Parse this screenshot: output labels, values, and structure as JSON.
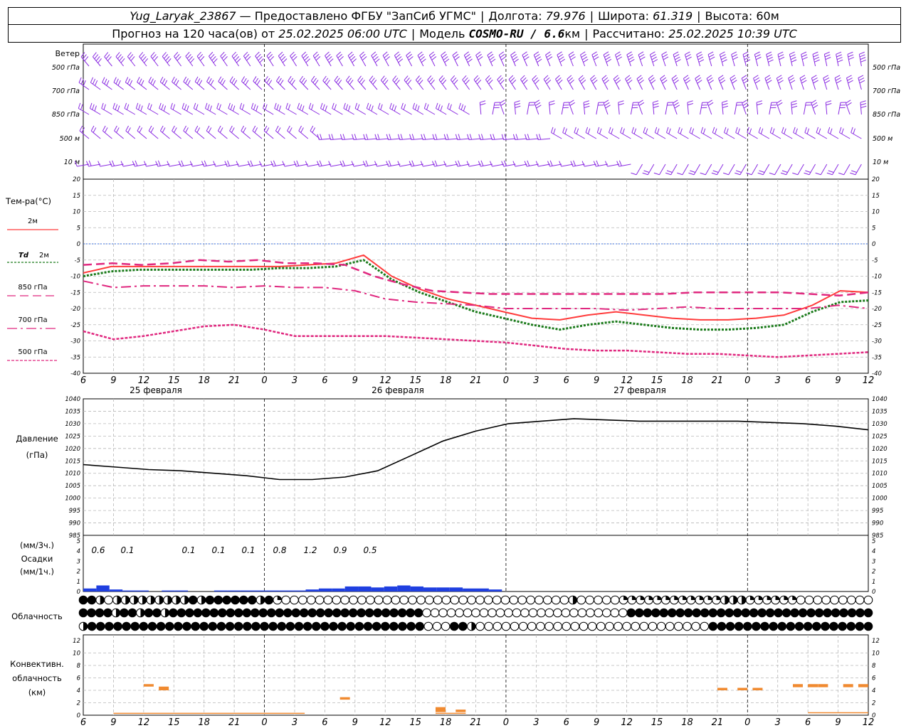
{
  "header": {
    "station": "Yug_Laryak_23867",
    "provider": "— Предоставлено ФГБУ \"ЗапСиб УГМС\"",
    "lon_label": "Долгота:",
    "lon": "79.976",
    "lat_label": "Широта:",
    "lat": "61.319",
    "alt_label": "Высота:",
    "alt": "60м",
    "forecast_label": "Прогноз на 120 часа(ов) от",
    "run": "25.02.2025 06:00 UTC",
    "model_label": "Модель",
    "model": "COSMO-RU / 6.6",
    "model_unit": "км",
    "calc_label": "Рассчитано:",
    "calc": "25.02.2025 10:39 UTC"
  },
  "colors": {
    "t2m": "#ff3b3b",
    "td2m": "#1a7a1a",
    "t850": "#e0287f",
    "wind": "#8a2be2",
    "precip": "#1f3fe0",
    "conv": "#f08a30",
    "pressure": "#000000",
    "zero": "#3a6fe0",
    "grid": "#b8b8b8"
  },
  "x_ticks": [
    "6",
    "9",
    "12",
    "15",
    "18",
    "21",
    "0",
    "3",
    "6",
    "9",
    "12",
    "15",
    "18",
    "21",
    "0",
    "3",
    "6",
    "9",
    "12",
    "15",
    "18",
    "21",
    "0",
    "3",
    "6",
    "9",
    "12"
  ],
  "dates": [
    "25 февраля",
    "26 февраля",
    "27 февраля"
  ],
  "wind": {
    "title": "Ветер",
    "levels": [
      "500 гПа",
      "700 гПа",
      "850 гПа",
      "500 м",
      "10 м"
    ]
  },
  "labels": {
    "temp_title": "Тем-ра(°С)",
    "t2m": "2м",
    "td": "Td",
    "td_lvl": "2м",
    "t850": "850 гПа",
    "t700": "700 гПа",
    "t500": "500 гПа",
    "pressure_title": "Давление",
    "pressure_unit": "(гПа)",
    "precip_unit3": "(мм/3ч.)",
    "precip_title": "Осадки",
    "precip_unit1": "(мм/1ч.)",
    "cloud_title": "Облачность",
    "conv_title": "Конвективн.",
    "conv_title2": "облачность",
    "conv_unit": "(км)"
  },
  "chart_data": [
    {
      "type": "line",
      "panel": "temperature",
      "ylim": [
        -40,
        20
      ],
      "yticks": [
        "20",
        "15",
        "10",
        "5",
        "0",
        "-5",
        "-10",
        "-15",
        "-20",
        "-25",
        "-30",
        "-35",
        "-40"
      ],
      "x_hours": [
        0,
        3,
        6,
        9,
        12,
        15,
        18,
        21,
        24,
        27,
        30,
        33,
        36,
        39,
        42,
        45,
        48,
        51,
        54,
        57,
        60,
        63,
        66,
        69,
        72,
        75,
        78
      ],
      "series": [
        {
          "name": "2м",
          "values": [
            -9,
            -7,
            -7,
            -7,
            -7,
            -7,
            -7,
            -7,
            -6.5,
            -6,
            -3.5,
            -10,
            -14,
            -17,
            -19,
            -21,
            -23,
            -23.5,
            -22,
            -21,
            -22,
            -23,
            -23.5,
            -23.5,
            -23,
            -22,
            -19,
            -14.5,
            -15
          ]
        },
        {
          "name": "Td 2м",
          "values": [
            -10,
            -8.5,
            -8,
            -8,
            -8,
            -8,
            -8,
            -7.5,
            -7.5,
            -7,
            -5,
            -11,
            -15,
            -18,
            -21,
            -23,
            -25,
            -26.5,
            -25,
            -24,
            -25,
            -26,
            -26.5,
            -26.5,
            -26,
            -25,
            -21,
            -18,
            -17.5
          ]
        },
        {
          "name": "850 гПа",
          "values": [
            -6.5,
            -6,
            -6.5,
            -6,
            -5,
            -5.5,
            -5,
            -6,
            -6,
            -6.5,
            -10,
            -12.5,
            -14.5,
            -15,
            -15.5,
            -15.5,
            -15.5,
            -15.5,
            -15.5,
            -15.5,
            -15.5,
            -15,
            -15,
            -15,
            -15,
            -15.5,
            -16,
            -15
          ]
        },
        {
          "name": "700 гПа",
          "values": [
            -11.5,
            -13.5,
            -13,
            -13,
            -13,
            -13.5,
            -13,
            -13.5,
            -13.5,
            -14.5,
            -17,
            -18,
            -18.5,
            -19,
            -20,
            -20,
            -20,
            -20,
            -20.5,
            -20,
            -19.5,
            -20,
            -20,
            -20,
            -20,
            -19,
            -20
          ]
        },
        {
          "name": "500 гПа",
          "values": [
            -27,
            -29.5,
            -28.5,
            -27,
            -25.5,
            -25,
            -26.5,
            -28.5,
            -28.5,
            -28.5,
            -28.5,
            -29,
            -29.5,
            -30,
            -30.5,
            -31.5,
            -32.5,
            -33,
            -33,
            -33.5,
            -34,
            -34,
            -34.5,
            -35,
            -34.5,
            -34,
            -33.5
          ]
        }
      ]
    },
    {
      "type": "line",
      "panel": "pressure",
      "ylim": [
        985,
        1040
      ],
      "yticks": [
        "1040",
        "1035",
        "1030",
        "1025",
        "1020",
        "1015",
        "1010",
        "1005",
        "1000",
        "995",
        "990",
        "985"
      ],
      "series": [
        {
          "name": "Давление",
          "values": [
            1013.5,
            1012.5,
            1011.5,
            1011,
            1010,
            1009,
            1007.5,
            1007.5,
            1008.5,
            1011,
            1017,
            1023,
            1027,
            1030,
            1031,
            1032,
            1031.5,
            1031,
            1031,
            1031,
            1031,
            1030.5,
            1030,
            1029,
            1027.5
          ]
        }
      ]
    },
    {
      "type": "bar",
      "panel": "precipitation",
      "ylim": [
        0,
        5
      ],
      "yticks": [
        "5",
        "4",
        "3",
        "2",
        "1",
        "0"
      ],
      "labels_3h": [
        "0.6",
        "0.1",
        "0.1",
        "0.1",
        "0.1",
        "0.8",
        "1.2",
        "0.9",
        "0.5"
      ],
      "values_1h": [
        0.3,
        0.6,
        0.2,
        0.1,
        0.1,
        0,
        0.1,
        0.1,
        0,
        0,
        0.1,
        0.1,
        0.1,
        0.1,
        0.1,
        0.1,
        0.1,
        0.2,
        0.3,
        0.3,
        0.5,
        0.5,
        0.4,
        0.5,
        0.6,
        0.5,
        0.4,
        0.4,
        0.4,
        0.3,
        0.3,
        0.2
      ]
    },
    {
      "type": "bar",
      "panel": "convective_cloud",
      "ylim": [
        0,
        12
      ],
      "yticks": [
        "12",
        "10",
        "8",
        "6",
        "4",
        "2",
        "0"
      ],
      "bars": [
        {
          "h": 6.5,
          "top": 5,
          "bottom": 4.6
        },
        {
          "h": 8,
          "top": 4.6,
          "bottom": 4
        },
        {
          "h": 26,
          "top": 2.9,
          "bottom": 2.5
        },
        {
          "h": 35.5,
          "top": 1.3,
          "bottom": 0.5
        },
        {
          "h": 37.5,
          "top": 0.9,
          "bottom": 0.5
        },
        {
          "h": 63.5,
          "top": 4.4,
          "bottom": 4
        },
        {
          "h": 65.5,
          "top": 4.4,
          "bottom": 4
        },
        {
          "h": 67,
          "top": 4.4,
          "bottom": 4
        },
        {
          "h": 71,
          "top": 5,
          "bottom": 4.5
        },
        {
          "h": 72.5,
          "top": 5,
          "bottom": 4.5
        },
        {
          "h": 73.5,
          "top": 5,
          "bottom": 4.5
        },
        {
          "h": 76,
          "top": 5,
          "bottom": 4.5
        },
        {
          "h": 77.5,
          "top": 5,
          "bottom": 4.5
        }
      ],
      "low_hours": [
        3,
        6,
        9,
        12,
        15,
        18,
        21,
        24,
        27,
        30,
        33,
        36,
        54,
        57,
        72,
        75,
        78
      ]
    },
    {
      "type": "table",
      "panel": "cloudiness",
      "rows": [
        "upper",
        "middle",
        "lower"
      ],
      "upper": "ffhohhhhhhhhhfhffffffhfqoooooooooooooooooooooooooooooooooohoooooqqqqqqqqqqqqhhhqqqqqqooooooooo",
      "middle": "ffffhffhffhfffffffffffffffffffffffffffffffoooooooooooooooooooooooooffffffffffffffffffffffffffffff",
      "lower": "hfffffffffffffffffffffffffffffffffffffffoooffhooooooooooooooooooooooooooofffffffffffffffffff"
    }
  ]
}
